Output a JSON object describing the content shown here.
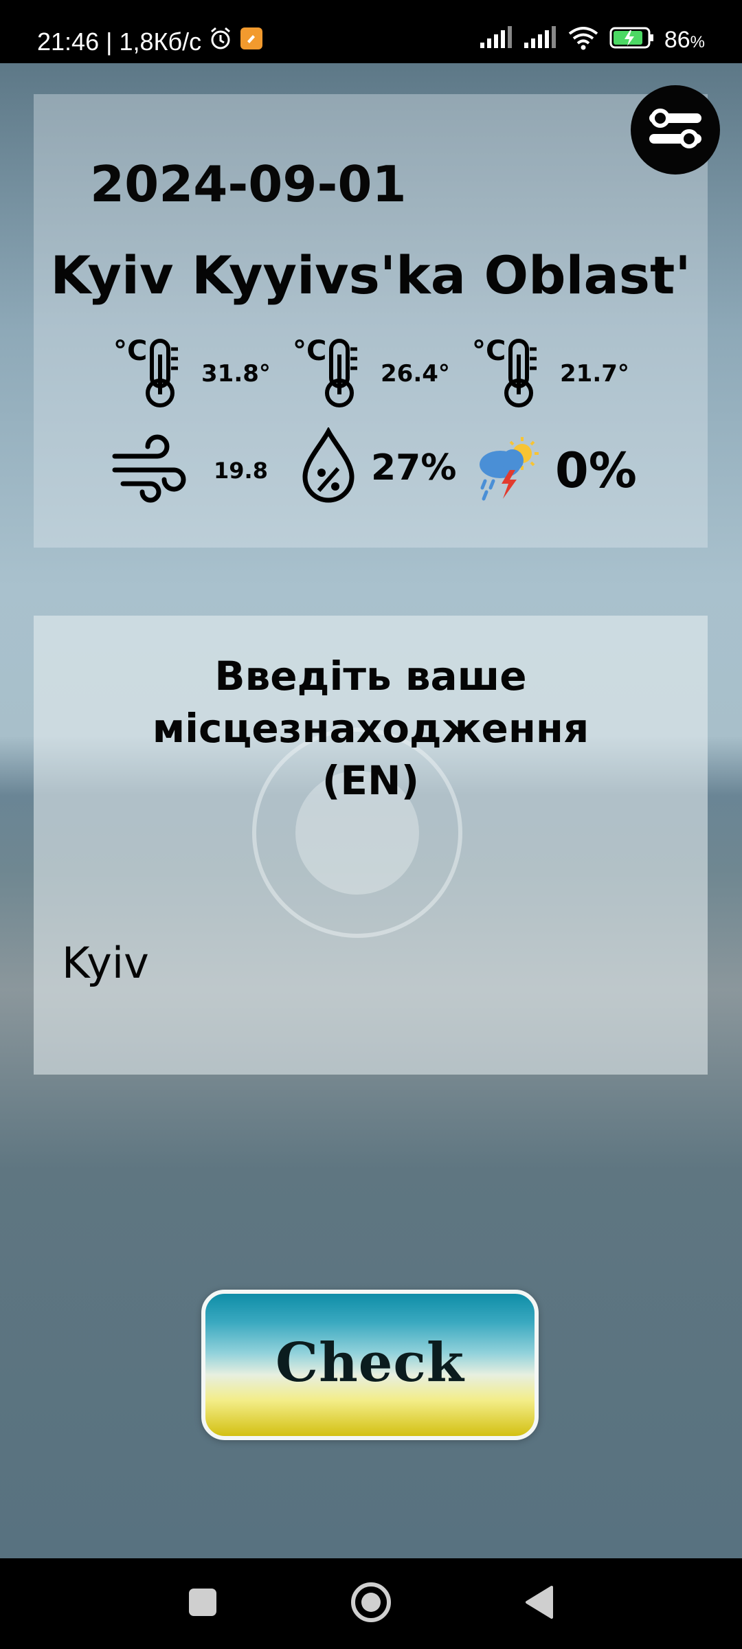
{
  "status_bar": {
    "time": "21:46",
    "speed": "1,8Кб/с",
    "battery": "86",
    "battery_unit": "%"
  },
  "weather": {
    "date": "2024-09-01",
    "location": "Kyiv Kyyivs'ka Oblast'",
    "temp_now": "31.8°",
    "temp_2": "26.4°",
    "temp_3": "21.7°",
    "wind": "19.8",
    "humidity": "27%",
    "precipitation": "0%"
  },
  "input": {
    "title_line1": "Введіть ваше",
    "title_line2": "місцезнаходження",
    "title_line3": "(EN)",
    "value": "Kyiv"
  },
  "actions": {
    "check_label": "Check"
  },
  "icons": {
    "menu": "tune-icon",
    "thermometer": "thermometer-celsius-icon",
    "wind": "wind-icon",
    "humidity": "humidity-drop-icon",
    "precip": "storm-rain-icon"
  }
}
